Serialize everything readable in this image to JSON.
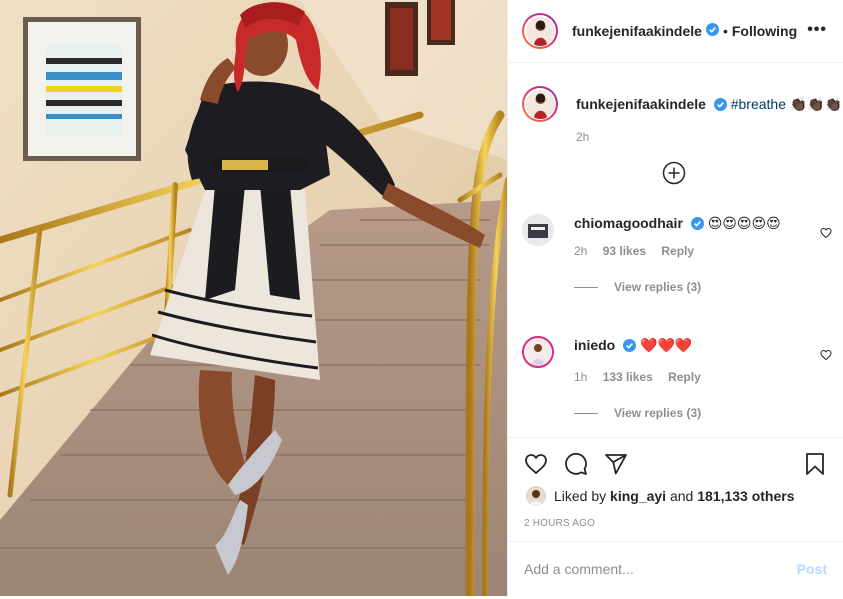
{
  "post": {
    "author": "funkejenifaakindele",
    "separator": "•",
    "follow_status": "Following",
    "more_label": "•••"
  },
  "caption": {
    "author": "funkejenifaakindele",
    "hashtag": "#breathe",
    "emoji": "👏🏿👏🏿👏🏿",
    "age": "2h"
  },
  "comments": [
    {
      "user": "chiomagoodhair",
      "text": "😍😍😍😍😍",
      "age": "2h",
      "likes": "93 likes",
      "reply": "Reply",
      "view_replies": "View replies (3)"
    },
    {
      "user": "iniedo",
      "text": "❤️❤️❤️",
      "age": "1h",
      "likes": "133 likes",
      "reply": "Reply",
      "view_replies": "View replies (3)"
    }
  ],
  "likes": {
    "prefix": "Liked by",
    "user": "king_ayi",
    "conj": "and",
    "others": "181,133 others"
  },
  "timestamp": "2 HOURS AGO",
  "add_comment": {
    "placeholder": "Add a comment...",
    "post_label": "Post"
  },
  "icons": [
    "verified-badge-icon",
    "more-icon",
    "add-icon",
    "heart-icon",
    "comment-icon",
    "share-icon",
    "bookmark-icon"
  ],
  "colors": {
    "verified": "#3897f0",
    "hashtag": "#00376b",
    "post_disabled": "#b3dbff",
    "meta": "#8e8e8e"
  }
}
